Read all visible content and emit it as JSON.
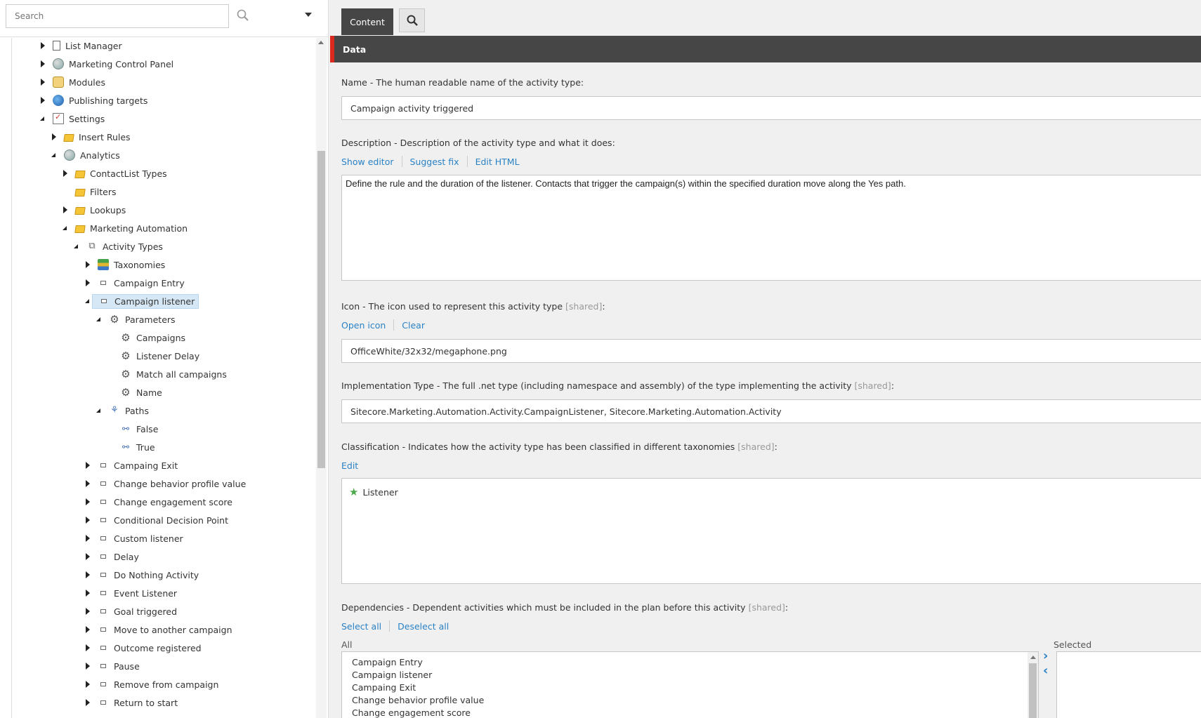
{
  "search": {
    "placeholder": "Search"
  },
  "icons": {
    "search": "search-icon",
    "dropdown": "chevron-down-icon",
    "content_search": "search-icon"
  },
  "tree": [
    {
      "label": "List Manager",
      "depth": 0,
      "toggle": "closed",
      "icon": "list-manager-icon"
    },
    {
      "label": "Marketing Control Panel",
      "depth": 0,
      "toggle": "closed",
      "icon": "globe-icon"
    },
    {
      "label": "Modules",
      "depth": 0,
      "toggle": "closed",
      "icon": "modules-icon"
    },
    {
      "label": "Publishing targets",
      "depth": 0,
      "toggle": "closed",
      "icon": "publishing-icon"
    },
    {
      "label": "Settings",
      "depth": 0,
      "toggle": "open",
      "icon": "settings-icon"
    },
    {
      "label": "Insert Rules",
      "depth": 1,
      "toggle": "closed",
      "icon": "folder-icon"
    },
    {
      "label": "Analytics",
      "depth": 1,
      "toggle": "open",
      "icon": "globe-icon"
    },
    {
      "label": "ContactList Types",
      "depth": 2,
      "toggle": "closed",
      "icon": "folder-icon"
    },
    {
      "label": "Filters",
      "depth": 2,
      "toggle": "none",
      "icon": "folder-icon"
    },
    {
      "label": "Lookups",
      "depth": 2,
      "toggle": "closed",
      "icon": "folder-icon"
    },
    {
      "label": "Marketing Automation",
      "depth": 2,
      "toggle": "open",
      "icon": "folder-icon"
    },
    {
      "label": "Activity Types",
      "depth": 3,
      "toggle": "open",
      "icon": "activity-types-icon"
    },
    {
      "label": "Taxonomies",
      "depth": 4,
      "toggle": "closed",
      "icon": "taxonomy-icon"
    },
    {
      "label": "Campaign Entry",
      "depth": 4,
      "toggle": "closed",
      "icon": "item-icon"
    },
    {
      "label": "Campaign listener",
      "depth": 4,
      "toggle": "open",
      "icon": "item-icon",
      "selected": true
    },
    {
      "label": "Parameters",
      "depth": 5,
      "toggle": "open",
      "icon": "gears-icon"
    },
    {
      "label": "Campaigns",
      "depth": 6,
      "toggle": "none",
      "icon": "gear-icon"
    },
    {
      "label": "Listener Delay",
      "depth": 6,
      "toggle": "none",
      "icon": "gear-icon"
    },
    {
      "label": "Match all campaigns",
      "depth": 6,
      "toggle": "none",
      "icon": "gear-icon"
    },
    {
      "label": "Name",
      "depth": 6,
      "toggle": "none",
      "icon": "gear-icon"
    },
    {
      "label": "Paths",
      "depth": 5,
      "toggle": "open",
      "icon": "paths-icon"
    },
    {
      "label": "False",
      "depth": 6,
      "toggle": "none",
      "icon": "link-icon"
    },
    {
      "label": "True",
      "depth": 6,
      "toggle": "none",
      "icon": "link-icon"
    },
    {
      "label": "Campaing Exit",
      "depth": 4,
      "toggle": "closed",
      "icon": "item-icon"
    },
    {
      "label": "Change behavior profile value",
      "depth": 4,
      "toggle": "closed",
      "icon": "item-icon"
    },
    {
      "label": "Change engagement score",
      "depth": 4,
      "toggle": "closed",
      "icon": "item-icon"
    },
    {
      "label": "Conditional Decision Point",
      "depth": 4,
      "toggle": "closed",
      "icon": "item-icon"
    },
    {
      "label": "Custom listener",
      "depth": 4,
      "toggle": "closed",
      "icon": "item-icon"
    },
    {
      "label": "Delay",
      "depth": 4,
      "toggle": "closed",
      "icon": "item-icon"
    },
    {
      "label": "Do Nothing Activity",
      "depth": 4,
      "toggle": "closed",
      "icon": "item-icon"
    },
    {
      "label": "Event Listener",
      "depth": 4,
      "toggle": "closed",
      "icon": "item-icon"
    },
    {
      "label": "Goal triggered",
      "depth": 4,
      "toggle": "closed",
      "icon": "item-icon"
    },
    {
      "label": "Move to another campaign",
      "depth": 4,
      "toggle": "closed",
      "icon": "item-icon"
    },
    {
      "label": "Outcome registered",
      "depth": 4,
      "toggle": "closed",
      "icon": "item-icon"
    },
    {
      "label": "Pause",
      "depth": 4,
      "toggle": "closed",
      "icon": "item-icon"
    },
    {
      "label": "Remove from campaign",
      "depth": 4,
      "toggle": "closed",
      "icon": "item-icon"
    },
    {
      "label": "Return to start",
      "depth": 4,
      "toggle": "closed",
      "icon": "item-icon"
    }
  ],
  "tabs": {
    "content": "Content"
  },
  "section": {
    "title": "Data"
  },
  "fields": {
    "name": {
      "label": "Name - The human readable name of the activity type:",
      "value": "Campaign activity triggered"
    },
    "description": {
      "label": "Description - Description of the activity type and what it does:",
      "links": [
        "Show editor",
        "Suggest fix",
        "Edit HTML"
      ],
      "value": "Define the rule and the duration of the listener. Contacts that trigger the campaign(s) within the specified duration move along the Yes path."
    },
    "icon": {
      "label": "Icon - The icon used to represent this activity type ",
      "shared": "[shared]",
      "suffix": ":",
      "links": [
        "Open icon",
        "Clear"
      ],
      "value": "OfficeWhite/32x32/megaphone.png"
    },
    "implementation": {
      "label": "Implementation Type - The full .net type (including namespace and assembly) of the type implementing the activity ",
      "shared": "[shared]",
      "suffix": ":",
      "value": "Sitecore.Marketing.Automation.Activity.CampaignListener, Sitecore.Marketing.Automation.Activity"
    },
    "classification": {
      "label": "Classification - Indicates how the activity type has been classified in different taxonomies ",
      "shared": "[shared]",
      "suffix": ":",
      "link": "Edit",
      "items": [
        "Listener"
      ]
    },
    "dependencies": {
      "label": "Dependencies - Dependent activities which must be included in the plan before this activity ",
      "shared": "[shared]",
      "suffix": ":",
      "links": [
        "Select all",
        "Deselect all"
      ],
      "all_label": "All",
      "selected_label": "Selected",
      "all_items": [
        "Campaign Entry",
        "Campaign listener",
        "Campaing Exit",
        "Change behavior profile value",
        "Change engagement score"
      ]
    }
  }
}
